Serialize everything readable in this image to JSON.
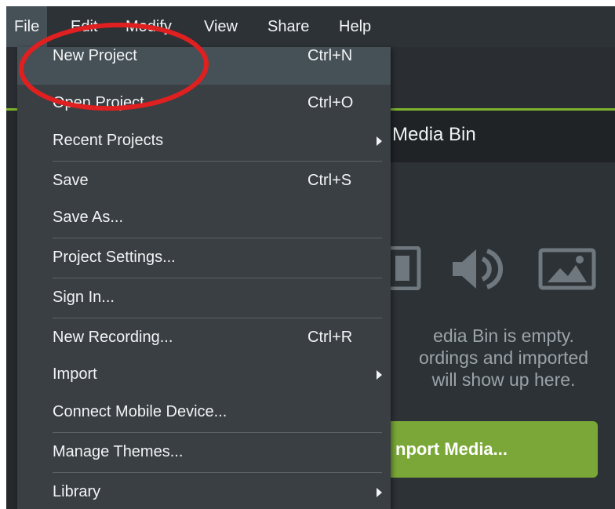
{
  "menubar": {
    "items": [
      "File",
      "Edit",
      "Modify",
      "View",
      "Share",
      "Help"
    ]
  },
  "file_menu": {
    "items": [
      {
        "label": "New Project",
        "shortcut": "Ctrl+N"
      },
      {
        "label": "Open Project",
        "shortcut": "Ctrl+O"
      },
      {
        "label": "Recent Projects",
        "submenu": true
      },
      {
        "label": "Save",
        "shortcut": "Ctrl+S"
      },
      {
        "label": "Save As..."
      },
      {
        "label": "Project Settings..."
      },
      {
        "label": "Sign In..."
      },
      {
        "label": "New Recording...",
        "shortcut": "Ctrl+R"
      },
      {
        "label": "Import",
        "submenu": true
      },
      {
        "label": "Connect Mobile Device..."
      },
      {
        "label": "Manage Themes..."
      },
      {
        "label": "Library",
        "submenu": true
      }
    ]
  },
  "media_bin": {
    "title": "Media Bin",
    "empty_line1": "edia Bin is empty.",
    "empty_line2": "ordings and imported",
    "empty_line3": "will show up here.",
    "import_button": "nport Media..."
  },
  "colors": {
    "accent_green": "#7aa737",
    "menu_bg": "#3a3f43",
    "annotation_red": "#e02020"
  },
  "icons": [
    "film-icon",
    "speaker-icon",
    "image-icon",
    "submenu-arrow-icon"
  ]
}
